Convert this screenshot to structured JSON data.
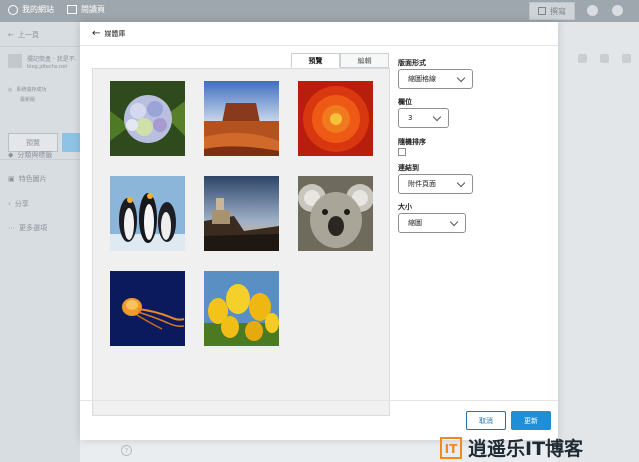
{
  "adminbar": {
    "site_label": "我的網站",
    "page_label": "閱讀頁",
    "publish_label": "撰寫"
  },
  "sidebar": {
    "back_label": "上一頁",
    "site_title": "擺記筒盒 · 我是不",
    "site_subtitle": "blog.jdtechs.net",
    "status_line1": "系統儲存成功",
    "status_line2": "最新版",
    "preview_button": "預覽",
    "items": [
      {
        "label": "分類與標籤"
      },
      {
        "label": "特色圖片"
      },
      {
        "label": "分享"
      },
      {
        "label": "更多選項"
      }
    ]
  },
  "modal": {
    "back_label": "媒體庫",
    "tabs": [
      {
        "label": "預覽",
        "active": true
      },
      {
        "label": "編輯",
        "active": false
      }
    ],
    "images": [
      {
        "name": "hydrangea"
      },
      {
        "name": "desert-butte"
      },
      {
        "name": "red-chrysanthemum"
      },
      {
        "name": "penguins"
      },
      {
        "name": "lighthouse-sunset"
      },
      {
        "name": "koala"
      },
      {
        "name": "jellyfish"
      },
      {
        "name": "yellow-tulips"
      }
    ],
    "settings": {
      "layout_label": "版面形式",
      "layout_value": "縮圖格線",
      "columns_label": "欄位",
      "columns_value": "3",
      "random_label": "隨機排序",
      "link_label": "連結到",
      "link_value": "附件頁面",
      "size_label": "大小",
      "size_value": "縮圖"
    },
    "cancel_label": "取消",
    "update_label": "更新"
  },
  "watermark": {
    "text": "逍遥乐IT博客",
    "logo_letters": "IT"
  },
  "colors": {
    "accent": "#1d8fd9",
    "admin_bar": "#9fa7ae",
    "watermark_orange": "#f08a1c"
  }
}
